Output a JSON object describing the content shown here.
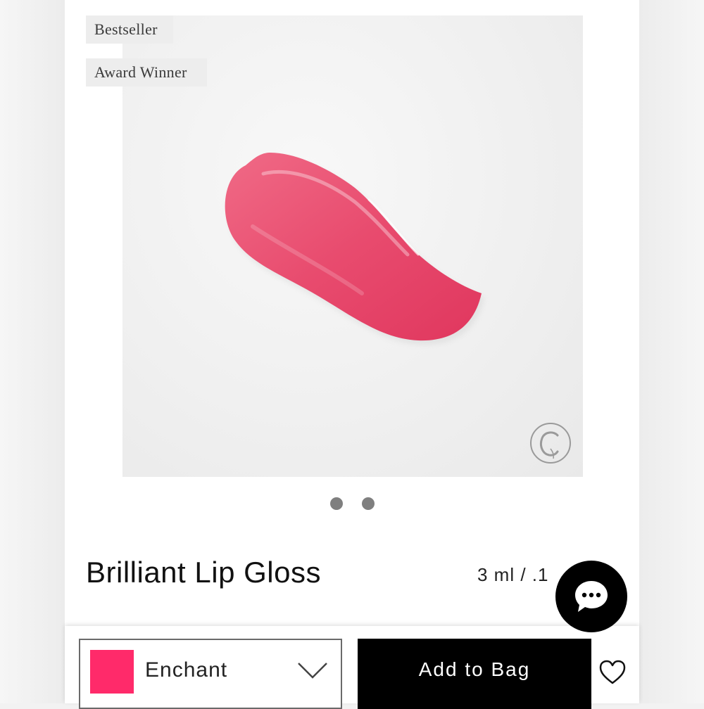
{
  "badges": [
    "Bestseller",
    "Award Winner"
  ],
  "product": {
    "title": "Brilliant Lip Gloss",
    "size": "3 ml / .1"
  },
  "carousel": {
    "dots": 2
  },
  "shade": {
    "name": "Enchant",
    "color": "#ff2a6a"
  },
  "actions": {
    "add_to_bag": "Add to Bag"
  },
  "icons": {
    "brand_logo": "brand-logo-c",
    "chevron": "chevron-down-icon",
    "wishlist": "heart-icon",
    "chat": "chat-icon"
  },
  "colors": {
    "swatch": "#e8476a",
    "button_bg": "#000000"
  }
}
